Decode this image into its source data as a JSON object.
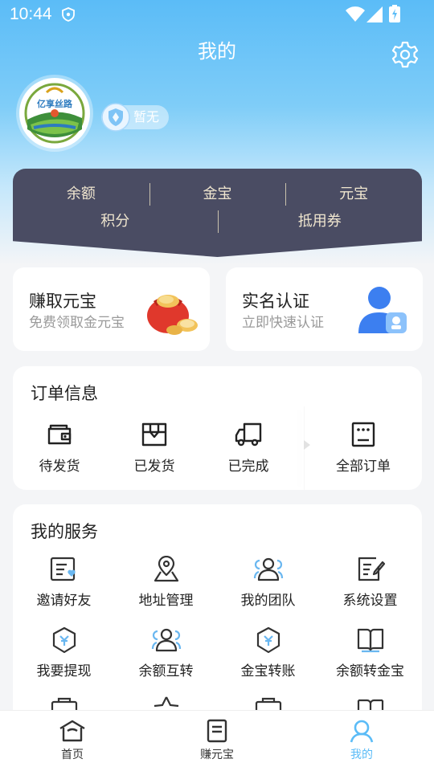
{
  "status": {
    "time": "10:44"
  },
  "header": {
    "title": "我的"
  },
  "profile": {
    "logo_text": "亿享丝路",
    "level_badge": "暂无"
  },
  "wallet": {
    "row1": [
      "余额",
      "金宝",
      "元宝"
    ],
    "row2": [
      "积分",
      "抵用券"
    ]
  },
  "promos": {
    "earn": {
      "title": "赚取元宝",
      "subtitle": "免费领取金元宝"
    },
    "verify": {
      "title": "实名认证",
      "subtitle": "立即快速认证"
    }
  },
  "orders": {
    "title": "订单信息",
    "items": [
      {
        "label": "待发货",
        "icon": "wallet-icon"
      },
      {
        "label": "已发货",
        "icon": "box-icon"
      },
      {
        "label": "已完成",
        "icon": "truck-icon"
      },
      {
        "label": "全部订单",
        "icon": "order-list-icon"
      }
    ]
  },
  "services": {
    "title": "我的服务",
    "items": [
      {
        "label": "邀请好友",
        "icon": "invite-icon"
      },
      {
        "label": "地址管理",
        "icon": "location-icon"
      },
      {
        "label": "我的团队",
        "icon": "team-icon"
      },
      {
        "label": "系统设置",
        "icon": "edit-settings-icon"
      },
      {
        "label": "我要提现",
        "icon": "withdraw-icon"
      },
      {
        "label": "余额互转",
        "icon": "transfer-icon"
      },
      {
        "label": "金宝转账",
        "icon": "gold-transfer-icon"
      },
      {
        "label": "余额转金宝",
        "icon": "book-icon"
      }
    ]
  },
  "tabbar": {
    "items": [
      {
        "label": "首页",
        "icon": "home-icon"
      },
      {
        "label": "赚元宝",
        "icon": "doc-icon"
      },
      {
        "label": "我的",
        "icon": "user-icon"
      }
    ]
  },
  "colors": {
    "accent": "#5bbcf7",
    "wallet_bg": "#4a4c63",
    "wallet_text": "#f0e6cf"
  }
}
